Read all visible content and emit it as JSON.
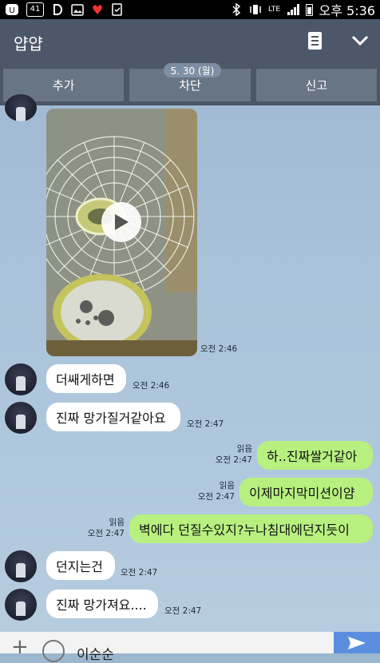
{
  "status_bar": {
    "left_badge": "41",
    "time": "오후 5:36",
    "network": "LTE"
  },
  "header": {
    "title": "얍얍",
    "date_pill": "5. 30 (월)"
  },
  "actions": [
    {
      "label": "추가"
    },
    {
      "label": "차단"
    },
    {
      "label": "신고"
    }
  ],
  "messages": [
    {
      "kind": "video",
      "time": "오전 2:46"
    },
    {
      "kind": "in",
      "text": "더쌔게하면",
      "time": "오전 2:46"
    },
    {
      "kind": "in",
      "text": "진짜 망가질거같아요",
      "time": "오전 2:47"
    },
    {
      "kind": "out",
      "text": "하..진짜쌀거같아",
      "read": "읽음",
      "time": "오전 2:47"
    },
    {
      "kind": "out",
      "text": "이제마지막미션이얌",
      "read": "읽음",
      "time": "오전 2:47"
    },
    {
      "kind": "out",
      "text": "벽에다 던질수있지?누나침대에던지듯이",
      "read": "읽음",
      "time": "오전 2:47"
    },
    {
      "kind": "in",
      "text": "던지는건",
      "time": "오전 2:47"
    },
    {
      "kind": "in",
      "text": "진짜 망가져요....",
      "time": "오전 2:47"
    }
  ],
  "input": {
    "value": "이순순"
  },
  "colors": {
    "header": "#4c5869",
    "outgoing_bubble": "#b8f080",
    "chat_bg": "#a9c3da",
    "send": "#5a8fe0"
  }
}
